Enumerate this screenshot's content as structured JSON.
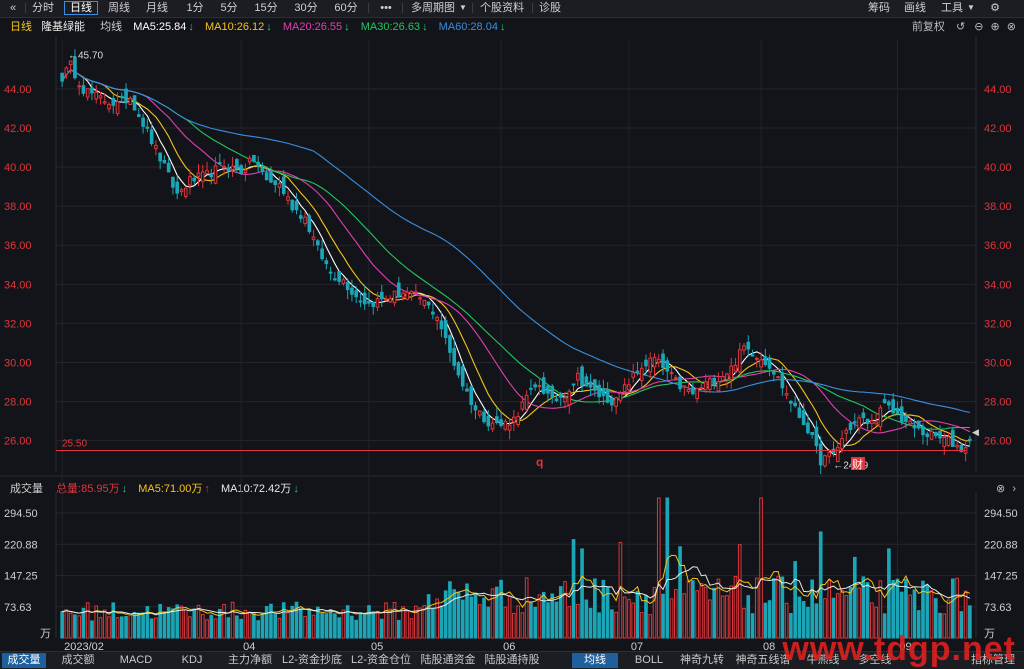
{
  "toolbar": {
    "left_icon": "double-chevron-left-icon",
    "tabs": [
      "分时",
      "日线",
      "周线",
      "月线",
      "1分",
      "5分",
      "15分",
      "30分",
      "60分"
    ],
    "active_tab": "日线",
    "more": "•••",
    "period": "多周期图",
    "profile": "个股资料",
    "diagnose": "诊股",
    "right": [
      "筹码",
      "画线",
      "工具"
    ],
    "settings_icon": "gear-icon"
  },
  "main_header": {
    "period": "日线",
    "name": "隆基绿能",
    "avg_label": "均线",
    "ma": [
      {
        "text": "MA5:25.84",
        "arrow": "↓",
        "color": "#ffffff"
      },
      {
        "text": "MA10:26.12",
        "arrow": "↓",
        "color": "#f5c518"
      },
      {
        "text": "MA20:26.55",
        "arrow": "↓",
        "color": "#e040b0"
      },
      {
        "text": "MA30:26.63",
        "arrow": "↓",
        "color": "#22c55e"
      },
      {
        "text": "MA60:28.04",
        "arrow": "↓",
        "color": "#3a8fe0"
      }
    ],
    "adjust": "前复权"
  },
  "volume_header": {
    "label": "成交量",
    "total": "总量:85.95万",
    "total_arrow": "↓",
    "ma5": "MA5:71.00万",
    "ma5_arrow": "↑",
    "ma10": "MA10:72.42万",
    "ma10_arrow": "↓"
  },
  "bottom_tabs": [
    "成交量",
    "成交额",
    "MACD",
    "KDJ",
    "主力净额",
    "L2-资金抄底",
    "L2-资金仓位",
    "陆股通资金",
    "陆股通持股"
  ],
  "bottom_tabs2": [
    "均线",
    "BOLL",
    "神奇九转",
    "神奇五线谱",
    "牛熊线",
    "多空线",
    "指标管理"
  ],
  "watermark": "www.tdgp.net",
  "chart_data": {
    "type": "candlestick",
    "price_ylim": [
      24.5,
      46.5
    ],
    "price_ticks": [
      "44.00",
      "42.00",
      "40.00",
      "38.00",
      "36.00",
      "34.00",
      "32.00",
      "30.00",
      "28.00",
      "26.00"
    ],
    "volume_ylim": [
      0,
      330
    ],
    "volume_ticks": [
      "294.50",
      "220.88",
      "147.25",
      "73.63"
    ],
    "volume_unit": "万",
    "x_labels": [
      "2023/02",
      "04",
      "05",
      "06",
      "07",
      "08",
      "09"
    ],
    "annotations": {
      "high": "45.70",
      "low": "24.79",
      "support": "25.50",
      "q_marker": "q",
      "cai_marker": "财"
    },
    "colors": {
      "up": "#e0353b",
      "down": "#1aa6b7",
      "ma5": "#ffffff",
      "ma10": "#f5c518",
      "ma20": "#e040b0",
      "ma30": "#22c55e",
      "ma60": "#3a8fe0"
    },
    "close_anchors": [
      [
        0,
        44.6
      ],
      [
        2,
        45.2
      ],
      [
        5,
        44.0
      ],
      [
        9,
        43.5
      ],
      [
        13,
        43.2
      ],
      [
        16,
        43.6
      ],
      [
        20,
        41.8
      ],
      [
        24,
        40.0
      ],
      [
        27,
        38.6
      ],
      [
        30,
        39.3
      ],
      [
        34,
        39.6
      ],
      [
        38,
        40.1
      ],
      [
        42,
        39.8
      ],
      [
        45,
        40.4
      ],
      [
        48,
        39.3
      ],
      [
        51,
        39.1
      ],
      [
        54,
        38.0
      ],
      [
        57,
        37.4
      ],
      [
        60,
        35.8
      ],
      [
        63,
        34.6
      ],
      [
        66,
        34.2
      ],
      [
        69,
        33.4
      ],
      [
        72,
        33.0
      ],
      [
        76,
        33.3
      ],
      [
        80,
        33.6
      ],
      [
        84,
        33.3
      ],
      [
        88,
        32.4
      ],
      [
        91,
        30.5
      ],
      [
        94,
        28.9
      ],
      [
        97,
        27.6
      ],
      [
        100,
        27.0
      ],
      [
        103,
        26.8
      ],
      [
        106,
        27.1
      ],
      [
        109,
        28.2
      ],
      [
        112,
        28.9
      ],
      [
        115,
        28.0
      ],
      [
        118,
        28.4
      ],
      [
        121,
        29.3
      ],
      [
        124,
        28.6
      ],
      [
        127,
        28.2
      ],
      [
        130,
        28.0
      ],
      [
        133,
        29.0
      ],
      [
        136,
        29.8
      ],
      [
        139,
        30.2
      ],
      [
        142,
        29.5
      ],
      [
        145,
        28.8
      ],
      [
        148,
        28.4
      ],
      [
        151,
        28.9
      ],
      [
        154,
        29.2
      ],
      [
        157,
        29.7
      ],
      [
        160,
        30.8
      ],
      [
        163,
        30.4
      ],
      [
        166,
        29.9
      ],
      [
        169,
        28.8
      ],
      [
        172,
        27.6
      ],
      [
        175,
        26.6
      ],
      [
        178,
        25.0
      ],
      [
        181,
        25.3
      ],
      [
        184,
        26.5
      ],
      [
        187,
        27.1
      ],
      [
        190,
        26.9
      ],
      [
        193,
        27.8
      ],
      [
        196,
        27.3
      ],
      [
        199,
        26.8
      ],
      [
        202,
        26.4
      ],
      [
        205,
        26.2
      ],
      [
        208,
        26.0
      ],
      [
        211,
        25.6
      ],
      [
        213,
        25.9
      ]
    ],
    "volume_peaks": [
      {
        "i": 120,
        "v": 232
      },
      {
        "i": 122,
        "v": 210
      },
      {
        "i": 131,
        "v": 225
      },
      {
        "i": 140,
        "v": 330
      },
      {
        "i": 142,
        "v": 330
      },
      {
        "i": 145,
        "v": 215
      },
      {
        "i": 159,
        "v": 220
      },
      {
        "i": 164,
        "v": 330
      },
      {
        "i": 172,
        "v": 180
      },
      {
        "i": 178,
        "v": 250
      },
      {
        "i": 186,
        "v": 190
      },
      {
        "i": 194,
        "v": 210
      }
    ]
  }
}
